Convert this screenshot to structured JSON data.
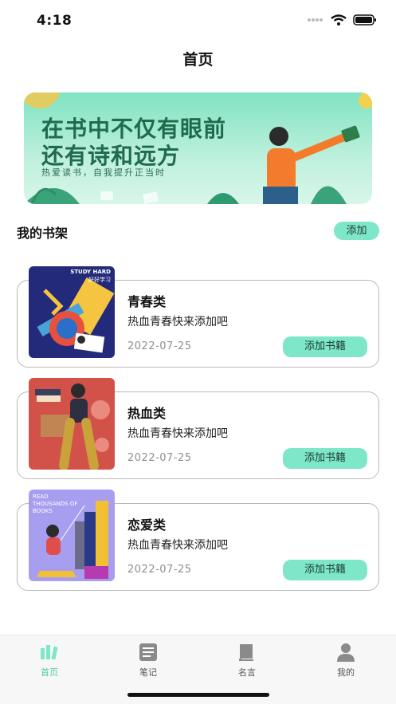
{
  "status_bar": {
    "time": "4:18"
  },
  "nav": {
    "title": "首页"
  },
  "banner": {
    "line1": "在书中不仅有眼前",
    "line2": "还有诗和远方",
    "subtitle": "热爱读书，自我提升正当时"
  },
  "shelf": {
    "title": "我的书架",
    "add_label": "添加",
    "cards": [
      {
        "title": "青春类",
        "desc": "热血青春快来添加吧",
        "date": "2022-07-25",
        "button": "添加书籍",
        "cover_text": "STUDY HARD",
        "cover_sub": "好好学习"
      },
      {
        "title": "热血类",
        "desc": "热血青春快来添加吧",
        "date": "2022-07-25",
        "button": "添加书籍"
      },
      {
        "title": "恋爱类",
        "desc": "热血青春快来添加吧",
        "date": "2022-07-25",
        "button": "添加书籍",
        "cover_text": "READ THOUSANDS OF BOOKS"
      }
    ]
  },
  "tabbar": {
    "tabs": [
      {
        "label": "首页",
        "icon": "home-books-icon",
        "active": true
      },
      {
        "label": "笔记",
        "icon": "notes-icon",
        "active": false
      },
      {
        "label": "名言",
        "icon": "book-icon",
        "active": false
      },
      {
        "label": "我的",
        "icon": "person-icon",
        "active": false
      }
    ]
  },
  "colors": {
    "accent": "#7ee6c9",
    "active_tab": "#4fc9a6"
  }
}
